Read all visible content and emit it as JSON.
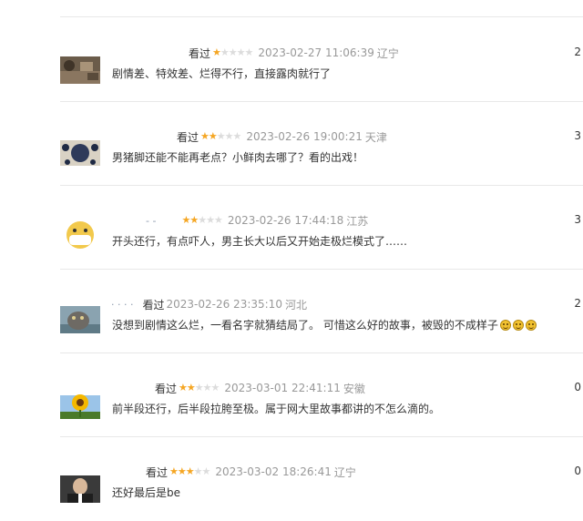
{
  "comments": [
    {
      "nickname": "",
      "watched": "看过",
      "rating": 1,
      "time": "2023-02-27 11:06:39",
      "location": "辽宁",
      "text": "剧情差、特效差、烂得不行，直接露肉就行了",
      "count": "2",
      "avatar": "avatar-ruins"
    },
    {
      "nickname": "",
      "watched": "看过",
      "rating": 2,
      "time": "2023-02-26 19:00:21",
      "location": "天津",
      "text": "男猪脚还能不能再老点？小鲜肉去哪了？看的出戏！",
      "count": "3",
      "avatar": "avatar-pattern"
    },
    {
      "nickname": "- -",
      "watched": "",
      "rating": 2,
      "time": "2023-02-26 17:44:18",
      "location": "江苏",
      "text": "开头还行，有点吓人，男主长大以后又开始走极烂模式了……",
      "count": "3",
      "avatar": "avatar-mask-face"
    },
    {
      "nickname": "· · · ·",
      "watched": "看过",
      "rating": 0,
      "time": "2023-02-26 23:35:10",
      "location": "河北",
      "text": "没想到剧情这么烂，一看名字就猜结局了。 可惜这么好的故事，被毁的不成样子",
      "emojis": 3,
      "count": "2",
      "avatar": "avatar-cat"
    },
    {
      "nickname": "",
      "watched": "看过",
      "rating": 2,
      "time": "2023-03-01 22:41:11",
      "location": "安徽",
      "text": "前半段还行，后半段拉胯至极。属于网大里故事都讲的不怎么滴的。",
      "count": "0",
      "avatar": "avatar-sunflower"
    },
    {
      "nickname": "",
      "watched": "看过",
      "rating": 3,
      "time": "2023-03-02 18:26:41",
      "location": "辽宁",
      "text": "还好最后是be",
      "count": "0",
      "avatar": "avatar-portrait"
    }
  ],
  "colors": {
    "star_on": "#f5a623",
    "star_off": "#dcdcdc",
    "meta": "#999999",
    "divider": "#e8e8e8"
  }
}
